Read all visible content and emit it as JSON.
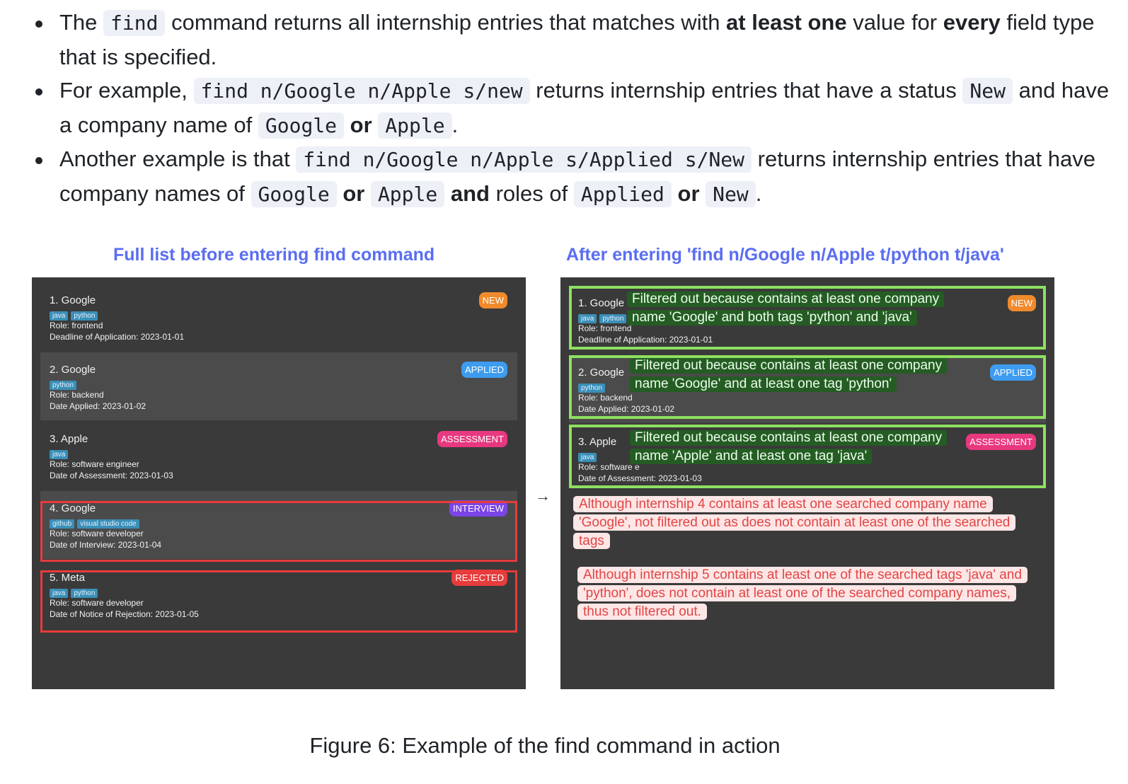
{
  "text": {
    "b1_a": "The ",
    "b1_code": "find",
    "b1_b": " command returns all internship entries that matches with ",
    "b1_bold1": "at least one",
    "b1_c": " value for ",
    "b1_bold2": "every",
    "b1_d": " field type that is specified.",
    "b2_a": "For example, ",
    "b2_code1": "find n/Google n/Apple s/new",
    "b2_b": " returns internship entries that have a status ",
    "b2_code2": "New",
    "b2_c": " and have a company name of ",
    "b2_code3": "Google",
    "b2_or": "or",
    "b2_code4": "Apple",
    "b2_d": ".",
    "b3_a": "Another example is that ",
    "b3_code1": "find n/Google n/Apple s/Applied s/New",
    "b3_b": " returns internship entries that have company names of ",
    "b3_code2": "Google",
    "b3_or1": "or",
    "b3_code3": "Apple",
    "b3_and": "and",
    "b3_c": " roles of ",
    "b3_code4": "Applied",
    "b3_or2": "or",
    "b3_code5": "New",
    "b3_d": "."
  },
  "figure": {
    "left_title": "Full list before entering find command",
    "right_title": "After entering 'find n/Google n/Apple t/python t/java'",
    "arrow": "→",
    "caption": "Figure 6: Example of the find command in action",
    "colors": {
      "title": "#5a6ef0",
      "panel": "#3a3a3a",
      "tag": "#3a8fb7",
      "new": "#f08a2c",
      "applied": "#3d9cf0",
      "assessment": "#e8387f",
      "interview": "#7b44e8",
      "rejected": "#e83b3b",
      "green_border": "#8ee060",
      "red_border": "#e83b3b"
    }
  },
  "left_cards": [
    {
      "name": "1. Google",
      "tags": [
        "java",
        "python"
      ],
      "line1": "Role: frontend",
      "line2": "Deadline of Application: 2023-01-01",
      "status": "NEW"
    },
    {
      "name": "2. Google",
      "tags": [
        "python"
      ],
      "line1": "Role: backend",
      "line2": "Date Applied: 2023-01-02",
      "status": "APPLIED"
    },
    {
      "name": "3. Apple",
      "tags": [
        "java"
      ],
      "line1": "Role: software engineer",
      "line2": "Date of Assessment: 2023-01-03",
      "status": "ASSESSMENT"
    },
    {
      "name": "4. Google",
      "tags": [
        "github",
        "visual studio code"
      ],
      "line1": "Role: software developer",
      "line2": "Date of Interview: 2023-01-04",
      "status": "INTERVIEW"
    },
    {
      "name": "5. Meta",
      "tags": [
        "java",
        "python"
      ],
      "line1": "Role: software developer",
      "line2": "Date of Notice of Rejection: 2023-01-05",
      "status": "REJECTED"
    }
  ],
  "right_cards": [
    {
      "name": "1. Google",
      "tags": [
        "java",
        "python"
      ],
      "line1": "Role: frontend",
      "line2": "Deadline of Application: 2023-01-01",
      "status": "NEW"
    },
    {
      "name": "2. Google",
      "tags": [
        "python"
      ],
      "line1": "Role: backend",
      "line2": "Date Applied: 2023-01-02",
      "status": "APPLIED"
    },
    {
      "name": "3. Apple",
      "tags": [
        "java"
      ],
      "line1": "Role: software e",
      "line2": "Date of Assessment: 2023-01-03",
      "status": "ASSESSMENT"
    }
  ],
  "notes": {
    "green1_a": "Filtered out because contains at least one company",
    "green1_b": "name 'Google' and both tags 'python' and 'java'",
    "green2_a": "Filtered out because contains at least one company",
    "green2_b": "name 'Google' and at least one tag 'python'",
    "green3_a": "Filtered out because contains at least one company",
    "green3_b": "name 'Apple' and at least one tag 'java'",
    "red1": "Although internship 4 contains at least one searched company name 'Google', not filtered out as does not contain at least one of the searched tags",
    "red2": "Although internship 5 contains at least one of the searched tags 'java' and 'python', does not contain at least one of the searched company names, thus not filtered out."
  }
}
